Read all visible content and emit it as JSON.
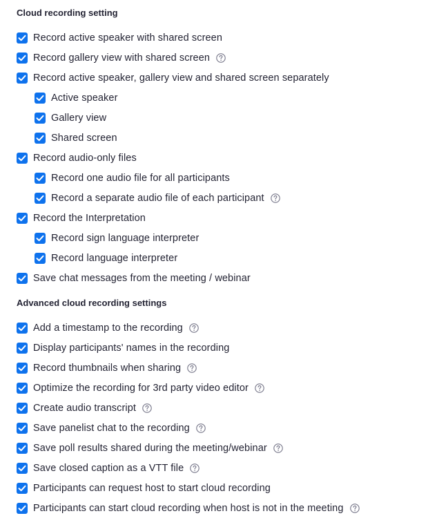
{
  "sections": {
    "cloud": {
      "title": "Cloud recording setting",
      "items": [
        {
          "label": "Record active speaker with shared screen",
          "checked": true,
          "help": false
        },
        {
          "label": "Record gallery view with shared screen",
          "checked": true,
          "help": true
        },
        {
          "label": "Record active speaker, gallery view and shared screen separately",
          "checked": true,
          "help": false
        },
        {
          "label": "Active speaker",
          "checked": true,
          "help": false
        },
        {
          "label": "Gallery view",
          "checked": true,
          "help": false
        },
        {
          "label": "Shared screen",
          "checked": true,
          "help": false
        },
        {
          "label": "Record audio-only files",
          "checked": true,
          "help": false
        },
        {
          "label": "Record one audio file for all participants",
          "checked": true,
          "help": false
        },
        {
          "label": "Record a separate audio file of each participant",
          "checked": true,
          "help": true
        },
        {
          "label": "Record the Interpretation",
          "checked": true,
          "help": false
        },
        {
          "label": "Record sign language interpreter",
          "checked": true,
          "help": false
        },
        {
          "label": "Record language interpreter",
          "checked": true,
          "help": false
        },
        {
          "label": "Save chat messages from the meeting / webinar",
          "checked": true,
          "help": false
        }
      ]
    },
    "advanced": {
      "title": "Advanced cloud recording settings",
      "items": [
        {
          "label": "Add a timestamp to the recording",
          "checked": true,
          "help": true
        },
        {
          "label": "Display participants' names in the recording",
          "checked": true,
          "help": false
        },
        {
          "label": "Record thumbnails when sharing",
          "checked": true,
          "help": true
        },
        {
          "label": "Optimize the recording for 3rd party video editor",
          "checked": true,
          "help": true
        },
        {
          "label": "Create audio transcript",
          "checked": true,
          "help": true
        },
        {
          "label": "Save panelist chat to the recording",
          "checked": true,
          "help": true
        },
        {
          "label": "Save poll results shared during the meeting/webinar",
          "checked": true,
          "help": true
        },
        {
          "label": "Save closed caption as a VTT file",
          "checked": true,
          "help": true
        },
        {
          "label": "Participants can request host to start cloud recording",
          "checked": true,
          "help": false
        },
        {
          "label": "Participants can start cloud recording when host is not in the meeting",
          "checked": true,
          "help": true
        }
      ]
    }
  },
  "colors": {
    "checkbox": "#0e72ed",
    "text": "#232333",
    "help_icon": "#747487"
  },
  "icons": {
    "checkbox": "checkmark-icon",
    "help": "question-circle-icon"
  }
}
